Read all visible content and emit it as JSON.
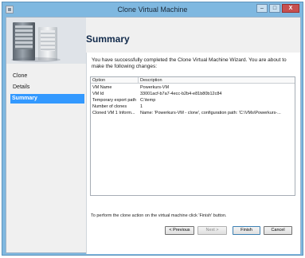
{
  "window": {
    "title": "Clone Virtual Machine",
    "buttons": {
      "minimize": "–",
      "maximize": "□",
      "close": "X"
    }
  },
  "page": {
    "title": "Summary"
  },
  "nav": {
    "items": [
      {
        "label": "Clone",
        "selected": false
      },
      {
        "label": "Details",
        "selected": false
      },
      {
        "label": "Summary",
        "selected": true
      }
    ]
  },
  "intro": "You have successfully completed the Clone Virtual Machine Wizard. You are about to make the following changes:",
  "grid": {
    "headers": [
      "Option",
      "Description"
    ],
    "rows": [
      {
        "option": "VM Name",
        "description": "Powerkurs-VM"
      },
      {
        "option": "VM Id",
        "description": "33001acf-b7a7-4ecc-b2b4-e81b80b12c84"
      },
      {
        "option": "Temporary export path",
        "description": "C:\\temp"
      },
      {
        "option": "Number of clones",
        "description": "1"
      },
      {
        "option": "Cloned VM 1 Inform...",
        "description": "Name: 'Powerkurs-VM - clone', configuration path: 'C:\\VMs\\Powerkurs-..."
      }
    ]
  },
  "footer_text": "To perform the clone action on the virtual machine click 'Finish' button.",
  "buttons": {
    "previous": "< Previous",
    "next": "Next >",
    "finish": "Finish",
    "cancel": "Cancel"
  }
}
